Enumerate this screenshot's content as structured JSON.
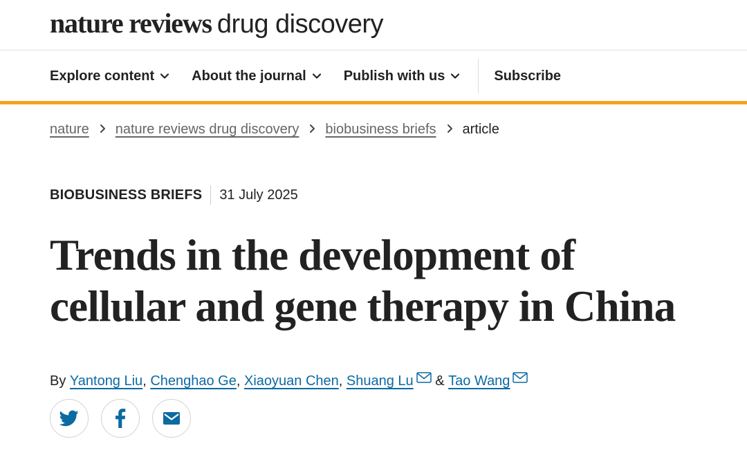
{
  "masthead": {
    "brand_bold": "nature reviews",
    "brand_light": "drug discovery"
  },
  "nav": {
    "items": [
      {
        "label": "Explore content",
        "icon": "chevron-down-icon"
      },
      {
        "label": "About the journal",
        "icon": "chevron-down-icon"
      },
      {
        "label": "Publish with us",
        "icon": "chevron-down-icon"
      }
    ],
    "subscribe": "Subscribe",
    "accent_color": "#f4a21d"
  },
  "breadcrumb": [
    "nature",
    "nature reviews drug discovery",
    "biobusiness briefs",
    "article"
  ],
  "article": {
    "section": "BIOBUSINESS BRIEFS",
    "date": "31 July 2025",
    "title_line1": "Trends in the development of",
    "title_line2": "cellular and gene therapy in China",
    "by": "By",
    "authors": [
      "Yantong Liu",
      "Chenghao Ge",
      "Xiaoyuan Chen",
      "Shuang Lu",
      "Tao Wang"
    ],
    "and": "&",
    "author_link_color": "#0b6aa2"
  },
  "share": [
    "twitter-icon",
    "facebook-icon",
    "email-icon"
  ]
}
